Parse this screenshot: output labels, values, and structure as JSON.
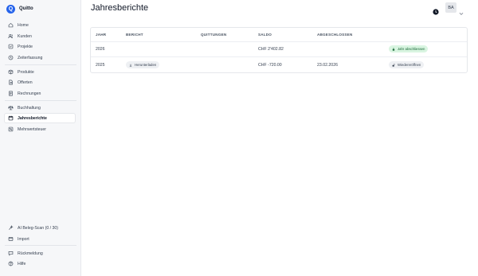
{
  "app": {
    "name": "Quitto"
  },
  "sidebar": {
    "main": [
      {
        "label": "Home",
        "icon": "home-icon"
      },
      {
        "label": "Kunden",
        "icon": "users-icon"
      },
      {
        "label": "Projekte",
        "icon": "folder-icon"
      },
      {
        "label": "Zeiterfassung",
        "icon": "clock-icon"
      }
    ],
    "sales": [
      {
        "label": "Produkte",
        "icon": "box-icon"
      },
      {
        "label": "Offerten",
        "icon": "document-icon"
      },
      {
        "label": "Rechnungen",
        "icon": "invoice-icon"
      }
    ],
    "accounting": [
      {
        "label": "Buchhaltung",
        "icon": "scale-icon"
      },
      {
        "label": "Jahresberichte",
        "icon": "calendar-icon",
        "active": true
      },
      {
        "label": "Mehrwertsteuer",
        "icon": "percent-icon"
      }
    ],
    "bottom": [
      {
        "label": "AI Beleg-Scan (0 / 30)",
        "icon": "sparkle-icon"
      },
      {
        "label": "Import",
        "icon": "import-icon"
      }
    ],
    "footer": [
      {
        "label": "Rückmeldung",
        "icon": "feedback-icon"
      },
      {
        "label": "Hilfe",
        "icon": "help-icon"
      }
    ]
  },
  "header": {
    "title": "Jahresberichte",
    "user_initials": "BA"
  },
  "table": {
    "columns": [
      "JAHR",
      "BERICHT",
      "QUITTUNGEN",
      "SALDO",
      "ABGESCHLOSSEN"
    ],
    "rows": [
      {
        "jahr": "2026",
        "bericht": "",
        "quittungen": "",
        "saldo": "CHF 2'402.82",
        "abgeschlossen": "",
        "action": "Jahr abschliessen",
        "action_style": "green"
      },
      {
        "jahr": "2025",
        "bericht": "Herunterladen",
        "quittungen": "",
        "saldo": "CHF -720.00",
        "abgeschlossen": "23.02.2026",
        "action": "Wiedereröffnen",
        "action_style": "grey"
      }
    ]
  },
  "colors": {
    "accent": "#2563eb",
    "success_bg": "#d9f5e1",
    "success_text": "#166534"
  }
}
